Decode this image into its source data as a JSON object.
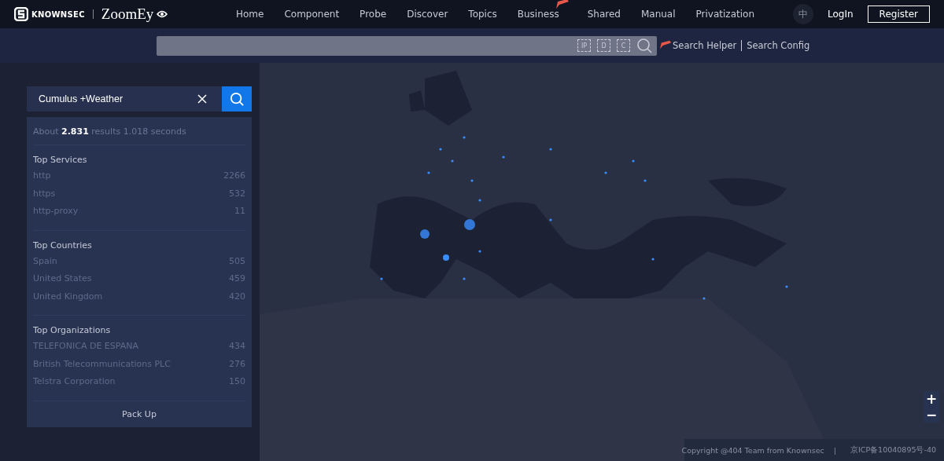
{
  "header": {
    "brand": "KNOWNSEC",
    "product": "ZoomEy",
    "nav": [
      {
        "label": "Home",
        "is_new": false
      },
      {
        "label": "Component",
        "is_new": false
      },
      {
        "label": "Probe",
        "is_new": false
      },
      {
        "label": "Discover",
        "is_new": false
      },
      {
        "label": "Topics",
        "is_new": false
      },
      {
        "label": "Business",
        "is_new": true
      },
      {
        "label": "Shared",
        "is_new": false
      },
      {
        "label": "Manual",
        "is_new": false
      },
      {
        "label": "Privatization",
        "is_new": false
      }
    ],
    "language": "中",
    "login": "LogIn",
    "register": "Register"
  },
  "search_bar": {
    "tools": [
      "IP",
      "D",
      "C"
    ],
    "helper": "Search Helper",
    "helper_is_new": true,
    "config": "Search Config"
  },
  "query": {
    "value": "Cumulus +Weather"
  },
  "summary": {
    "prefix": "About",
    "count": "2.831",
    "suffix": "results 1.018 seconds"
  },
  "sections": [
    {
      "title": "Top Services",
      "items": [
        {
          "name": "http",
          "count": "2266"
        },
        {
          "name": "https",
          "count": "532"
        },
        {
          "name": "http-proxy",
          "count": "11"
        }
      ]
    },
    {
      "title": "Top Countries",
      "items": [
        {
          "name": "Spain",
          "count": "505"
        },
        {
          "name": "United States",
          "count": "459"
        },
        {
          "name": "United Kingdom",
          "count": "420"
        }
      ]
    },
    {
      "title": "Top Organizations",
      "items": [
        {
          "name": "TELEFONICA DE ESPANA",
          "count": "434"
        },
        {
          "name": "British Telecommunications PLC",
          "count": "276"
        },
        {
          "name": "Telstra Corporation",
          "count": "150"
        }
      ]
    }
  ],
  "pack_up": "Pack Up",
  "zoom": [
    "+",
    "−"
  ],
  "footer": {
    "copyright": "Copyright @404 Team from Knownsec",
    "separator": "|",
    "icp": "京ICP备10040895号-40"
  }
}
